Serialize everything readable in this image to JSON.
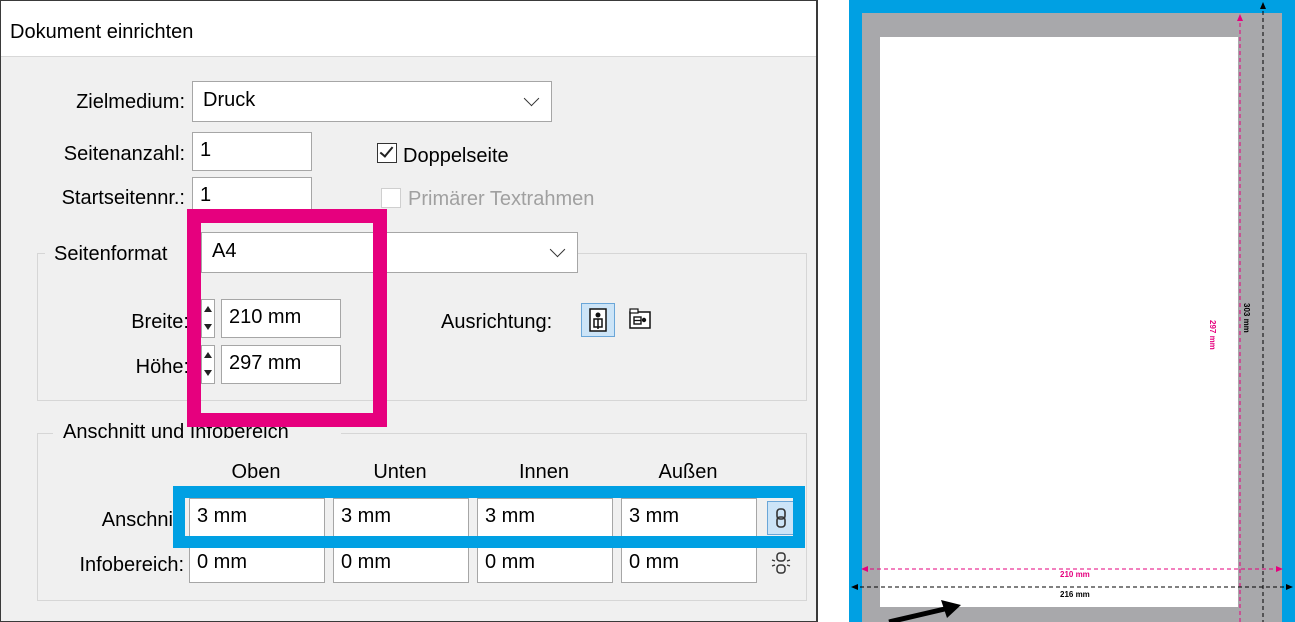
{
  "dialog": {
    "title": "Dokument einrichten",
    "zielmedium_label": "Zielmedium:",
    "zielmedium_value": "Druck",
    "seitenanzahl_label": "Seitenanzahl:",
    "seitenanzahl_value": "1",
    "startseite_label": "Startseitennr.:",
    "startseite_value": "1",
    "doppelseite_label": "Doppelseite",
    "doppelseite_checked": true,
    "primaer_label": "Primärer Textrahmen",
    "primaer_checked": false
  },
  "seitenformat": {
    "label": "Seitenformat",
    "value": "A4",
    "breite_label": "Breite:",
    "breite_value": "210 mm",
    "hoehe_label": "Höhe:",
    "hoehe_value": "297 mm",
    "ausrichtung_label": "Ausrichtung:",
    "orientation_selected": "portrait"
  },
  "anschnitt": {
    "group_label": "Anschnitt und Infobereich",
    "columns": [
      "Oben",
      "Unten",
      "Innen",
      "Außen"
    ],
    "anschnitt_label": "Anschnitt",
    "anschnitt_values": [
      "3 mm",
      "3 mm",
      "3 mm",
      "3 mm"
    ],
    "infobereich_label": "Infobereich:",
    "infobereich_values": [
      "0 mm",
      "0 mm",
      "0 mm",
      "0 mm"
    ]
  },
  "preview": {
    "width_trim": "210 mm",
    "width_bleed": "216 mm",
    "height_trim": "297 mm",
    "height_bleed": "303 mm"
  },
  "colors": {
    "highlight_magenta": "#e6007e",
    "highlight_cyan": "#00a0e3",
    "bleed_gray": "#a8a8ab"
  }
}
